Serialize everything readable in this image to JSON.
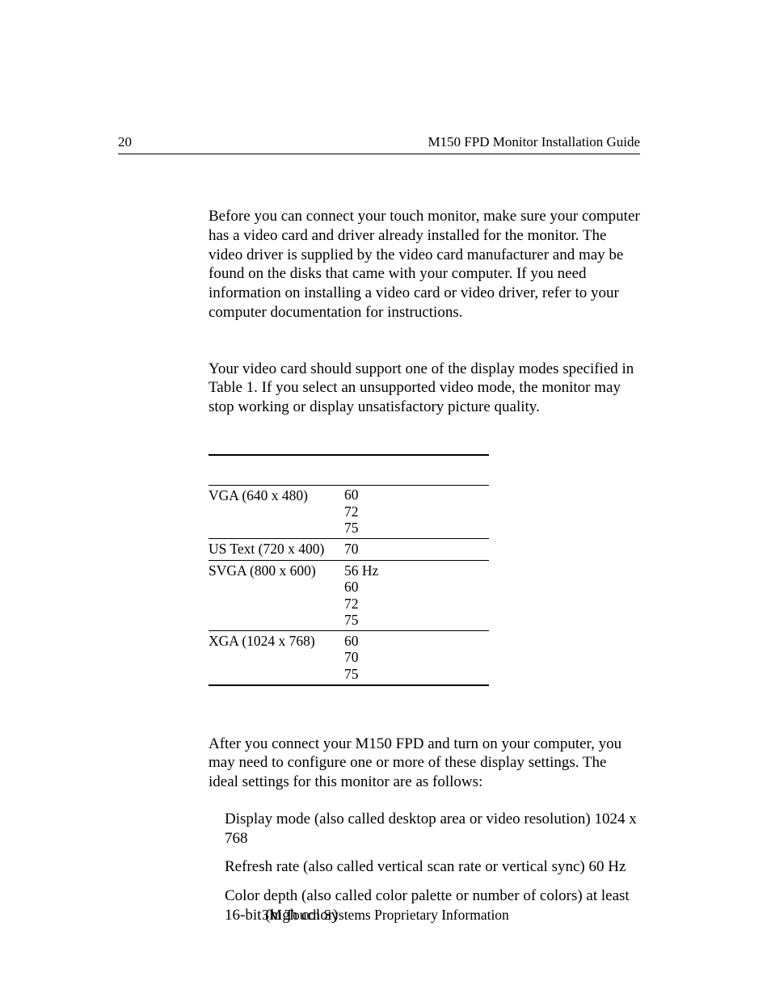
{
  "header": {
    "page_num": "20",
    "title": "M150 FPD Monitor Installation Guide"
  },
  "content": {
    "p1": "Before you can connect your touch monitor, make sure your computer has a video card and driver already installed for the monitor. The video driver is supplied by the video card manufacturer and may be found on the disks that came with your computer. If you need information on installing a video card or video driver, refer to your computer documentation for instructions.",
    "p2": "Your video card should support one of the display modes specified in Table 1.  If you select an unsupported video mode, the monitor may stop working or display unsatisfactory picture quality.",
    "p3": "After you connect your M150 FPD and turn on your computer, you may need to configure one or more of these display settings. The ideal settings for this monitor are as follows:"
  },
  "table": {
    "rows": [
      {
        "mode": "VGA (640 x 480)",
        "rates": [
          "60",
          "72",
          "75"
        ]
      },
      {
        "mode": "US Text (720 x 400)",
        "rates": [
          "70"
        ]
      },
      {
        "mode": "SVGA (800 x 600)",
        "rates": [
          "56 Hz",
          "60",
          "72",
          "75"
        ]
      },
      {
        "mode": "XGA (1024 x 768)",
        "rates": [
          "60",
          "70",
          "75"
        ]
      }
    ]
  },
  "bullets": {
    "b1": "Display mode (also called desktop area or video resolution) 1024 x 768",
    "b2": "Refresh rate (also called vertical scan rate or vertical sync) 60 Hz",
    "b3": "Color depth (also called color palette or number of colors) at least 16-bit (high color)"
  },
  "footer": "3M Touch Systems Proprietary Information"
}
